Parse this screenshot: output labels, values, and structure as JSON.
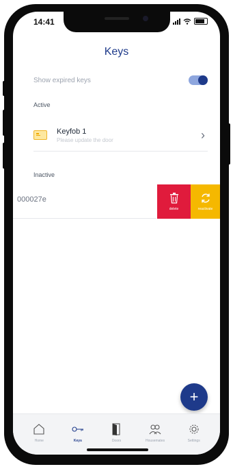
{
  "status_bar": {
    "time": "14:41"
  },
  "header": {
    "title": "Keys"
  },
  "settings": {
    "show_expired_label": "Show expired keys",
    "show_expired_on": true
  },
  "sections": {
    "active_label": "Active",
    "inactive_label": "Inactive"
  },
  "active_keys": [
    {
      "name": "Keyfob 1",
      "subtitle": "Please update the door",
      "icon": "keycard-icon"
    }
  ],
  "inactive_keys": [
    {
      "id": "000027e"
    }
  ],
  "swipe_actions": {
    "delete_label": "delete",
    "reactivate_label": "reactivate"
  },
  "fab": {
    "label": "+"
  },
  "tabbar": {
    "items": [
      {
        "label": "Home",
        "icon": "home-icon",
        "active": false
      },
      {
        "label": "Keys",
        "icon": "key-icon",
        "active": true
      },
      {
        "label": "Doors",
        "icon": "door-icon",
        "active": false
      },
      {
        "label": "Housemates",
        "icon": "people-icon",
        "active": false
      },
      {
        "label": "Settings",
        "icon": "gear-icon",
        "active": false
      }
    ]
  },
  "colors": {
    "accent": "#1e3a8a",
    "delete": "#e01b3c",
    "reactivate": "#f5b800"
  }
}
